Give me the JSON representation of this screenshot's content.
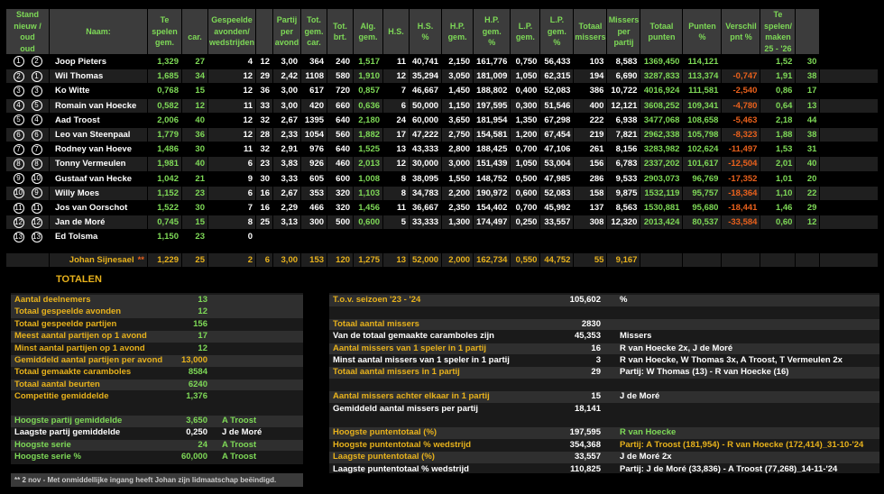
{
  "headers": [
    "Stand\nnieuw / oud\noud",
    "Naam:",
    "Te spelen\ngem.",
    "\ncar.",
    "Gespeelde\navonden/\nwedstrijden",
    "",
    "Partij\nper\navond",
    "Tot.\ngem.\ncar.",
    "Tot.\nbrt.",
    "Alg.\ngem.",
    "H.S.",
    "H.S.\n%",
    "H.P.\ngem.",
    "H.P.\ngem.\n%",
    "L.P.\ngem.",
    "L.P.\ngem.\n%",
    "Totaal\nmissers",
    "Missers\nper\npartij",
    "Totaal\npunten",
    "Punten\n%",
    "Verschil\npnt %",
    "Te spelen/\nmaken\n25 - '26",
    ""
  ],
  "players": [
    {
      "new": "1",
      "old": "2",
      "name": "Joop Pieters",
      "gem": "1,329",
      "car": "27",
      "avonden": "4",
      "partijen": "12",
      "per_avond": "3,00",
      "tot_car": "364",
      "brt": "240",
      "alg": "1,517",
      "alg_color": "g",
      "hs": "11",
      "hs_pct": "40,741",
      "hp": "2,150",
      "hp_pct": "161,776",
      "lp": "0,750",
      "lp_pct": "56,433",
      "missers": "103",
      "missers_pp": "8,583",
      "punten": "1369,450",
      "punten_pct": "114,121",
      "verschil": "",
      "ts_gem": "1,52",
      "ts_car": "30"
    },
    {
      "new": "2",
      "old": "1",
      "name": "Wil Thomas",
      "gem": "1,685",
      "car": "34",
      "avonden": "12",
      "partijen": "29",
      "per_avond": "2,42",
      "tot_car": "1108",
      "brt": "580",
      "alg": "1,910",
      "alg_color": "g",
      "hs": "12",
      "hs_pct": "35,294",
      "hp": "3,050",
      "hp_pct": "181,009",
      "lp": "1,050",
      "lp_pct": "62,315",
      "missers": "194",
      "missers_pp": "6,690",
      "punten": "3287,833",
      "punten_pct": "113,374",
      "verschil": "-0,747",
      "ts_gem": "1,91",
      "ts_car": "38"
    },
    {
      "new": "3",
      "old": "3",
      "name": "Ko Witte",
      "gem": "0,768",
      "car": "15",
      "avonden": "12",
      "partijen": "36",
      "per_avond": "3,00",
      "tot_car": "617",
      "brt": "720",
      "alg": "0,857",
      "alg_color": "g",
      "hs": "7",
      "hs_pct": "46,667",
      "hp": "1,450",
      "hp_pct": "188,802",
      "lp": "0,400",
      "lp_pct": "52,083",
      "missers": "386",
      "missers_pp": "10,722",
      "punten": "4016,924",
      "punten_pct": "111,581",
      "verschil": "-2,540",
      "ts_gem": "0,86",
      "ts_car": "17"
    },
    {
      "new": "4",
      "old": "5",
      "name": "Romain van Hoecke",
      "gem": "0,582",
      "car": "12",
      "avonden": "11",
      "partijen": "33",
      "per_avond": "3,00",
      "tot_car": "420",
      "brt": "660",
      "alg": "0,636",
      "alg_color": "g",
      "hs": "6",
      "hs_pct": "50,000",
      "hp": "1,150",
      "hp_pct": "197,595",
      "lp": "0,300",
      "lp_pct": "51,546",
      "missers": "400",
      "missers_pp": "12,121",
      "punten": "3608,252",
      "punten_pct": "109,341",
      "verschil": "-4,780",
      "ts_gem": "0,64",
      "ts_car": "13"
    },
    {
      "new": "5",
      "old": "4",
      "name": "Aad Troost",
      "gem": "2,006",
      "car": "40",
      "avonden": "12",
      "partijen": "32",
      "per_avond": "2,67",
      "tot_car": "1395",
      "brt": "640",
      "alg": "2,180",
      "alg_color": "g",
      "hs": "24",
      "hs_pct": "60,000",
      "hp": "3,650",
      "hp_pct": "181,954",
      "lp": "1,350",
      "lp_pct": "67,298",
      "missers": "222",
      "missers_pp": "6,938",
      "punten": "3477,068",
      "punten_pct": "108,658",
      "verschil": "-5,463",
      "ts_gem": "2,18",
      "ts_car": "44"
    },
    {
      "new": "6",
      "old": "6",
      "name": "Leo van Steenpaal",
      "gem": "1,779",
      "car": "36",
      "avonden": "12",
      "partijen": "28",
      "per_avond": "2,33",
      "tot_car": "1054",
      "brt": "560",
      "alg": "1,882",
      "alg_color": "g",
      "hs": "17",
      "hs_pct": "47,222",
      "hp": "2,750",
      "hp_pct": "154,581",
      "lp": "1,200",
      "lp_pct": "67,454",
      "missers": "219",
      "missers_pp": "7,821",
      "punten": "2962,338",
      "punten_pct": "105,798",
      "verschil": "-8,323",
      "ts_gem": "1,88",
      "ts_car": "38"
    },
    {
      "new": "7",
      "old": "7",
      "name": "Rodney van Hoeve",
      "gem": "1,486",
      "car": "30",
      "avonden": "11",
      "partijen": "32",
      "per_avond": "2,91",
      "tot_car": "976",
      "brt": "640",
      "alg": "1,525",
      "alg_color": "g",
      "hs": "13",
      "hs_pct": "43,333",
      "hp": "2,800",
      "hp_pct": "188,425",
      "lp": "0,700",
      "lp_pct": "47,106",
      "missers": "261",
      "missers_pp": "8,156",
      "punten": "3283,982",
      "punten_pct": "102,624",
      "verschil": "-11,497",
      "ts_gem": "1,53",
      "ts_car": "31"
    },
    {
      "new": "8",
      "old": "8",
      "name": "Tonny Vermeulen",
      "gem": "1,981",
      "car": "40",
      "avonden": "6",
      "partijen": "23",
      "per_avond": "3,83",
      "tot_car": "926",
      "brt": "460",
      "alg": "2,013",
      "alg_color": "g",
      "hs": "12",
      "hs_pct": "30,000",
      "hp": "3,000",
      "hp_pct": "151,439",
      "lp": "1,050",
      "lp_pct": "53,004",
      "missers": "156",
      "missers_pp": "6,783",
      "punten": "2337,202",
      "punten_pct": "101,617",
      "verschil": "-12,504",
      "ts_gem": "2,01",
      "ts_car": "40"
    },
    {
      "new": "9",
      "old": "10",
      "name": "Gustaaf van Hecke",
      "gem": "1,042",
      "car": "21",
      "avonden": "9",
      "partijen": "30",
      "per_avond": "3,33",
      "tot_car": "605",
      "brt": "600",
      "alg": "1,008",
      "alg_color": "g",
      "hs": "8",
      "hs_pct": "38,095",
      "hp": "1,550",
      "hp_pct": "148,752",
      "lp": "0,500",
      "lp_pct": "47,985",
      "missers": "286",
      "missers_pp": "9,533",
      "punten": "2903,073",
      "punten_pct": "96,769",
      "verschil": "-17,352",
      "ts_gem": "1,01",
      "ts_car": "20"
    },
    {
      "new": "10",
      "old": "9",
      "name": "Willy Moes",
      "gem": "1,152",
      "car": "23",
      "avonden": "6",
      "partijen": "16",
      "per_avond": "2,67",
      "tot_car": "353",
      "brt": "320",
      "alg": "1,103",
      "alg_color": "g",
      "hs": "8",
      "hs_pct": "34,783",
      "hp": "2,200",
      "hp_pct": "190,972",
      "lp": "0,600",
      "lp_pct": "52,083",
      "missers": "158",
      "missers_pp": "9,875",
      "punten": "1532,119",
      "punten_pct": "95,757",
      "verschil": "-18,364",
      "ts_gem": "1,10",
      "ts_car": "22"
    },
    {
      "new": "11",
      "old": "11",
      "name": "Jos van Oorschot",
      "gem": "1,522",
      "car": "30",
      "avonden": "7",
      "partijen": "16",
      "per_avond": "2,29",
      "tot_car": "466",
      "brt": "320",
      "alg": "1,456",
      "alg_color": "g",
      "hs": "11",
      "hs_pct": "36,667",
      "hp": "2,350",
      "hp_pct": "154,402",
      "lp": "0,700",
      "lp_pct": "45,992",
      "missers": "137",
      "missers_pp": "8,563",
      "punten": "1530,881",
      "punten_pct": "95,680",
      "verschil": "-18,441",
      "ts_gem": "1,46",
      "ts_car": "29"
    },
    {
      "new": "12",
      "old": "12",
      "name": "Jan de Moré",
      "gem": "0,745",
      "car": "15",
      "avonden": "8",
      "partijen": "25",
      "per_avond": "3,13",
      "tot_car": "300",
      "brt": "500",
      "alg": "0,600",
      "alg_color": "g",
      "hs": "5",
      "hs_pct": "33,333",
      "hp": "1,300",
      "hp_pct": "174,497",
      "lp": "0,250",
      "lp_pct": "33,557",
      "missers": "308",
      "missers_pp": "12,320",
      "punten": "2013,424",
      "punten_pct": "80,537",
      "verschil": "-33,584",
      "ts_gem": "0,60",
      "ts_car": "12"
    },
    {
      "new": "13",
      "old": "13",
      "name": "Ed Tolsma",
      "gem": "1,150",
      "car": "23",
      "avonden": "0",
      "partijen": "",
      "per_avond": "",
      "tot_car": "",
      "brt": "",
      "alg": "",
      "alg_color": "g",
      "hs": "",
      "hs_pct": "",
      "hp": "",
      "hp_pct": "",
      "lp": "",
      "lp_pct": "",
      "missers": "",
      "missers_pp": "",
      "punten": "",
      "punten_pct": "",
      "verschil": "",
      "ts_gem": "",
      "ts_car": ""
    }
  ],
  "johan": {
    "name": "Johan Sijnesael",
    "mark": "**",
    "gem": "1,229",
    "car": "25",
    "avonden": "2",
    "partijen": "6",
    "per_avond": "3,00",
    "tot_car": "153",
    "brt": "120",
    "alg": "1,275",
    "hs": "13",
    "hs_pct": "52,000",
    "hp": "2,000",
    "hp_pct": "162,734",
    "lp": "0,550",
    "lp_pct": "44,752",
    "missers": "55",
    "missers_pp": "9,167"
  },
  "totalen_title": "TOTALEN",
  "left_rows": [
    {
      "label": "Aantal deelnemers",
      "value": "13",
      "extra": "",
      "lc": "y",
      "vc": "g",
      "xc": "g",
      "hl": true
    },
    {
      "label": "Totaal gespeelde avonden",
      "value": "12",
      "extra": "",
      "lc": "y",
      "vc": "g",
      "xc": "g",
      "hl": true
    },
    {
      "label": "Totaal gespeelde partijen",
      "value": "156",
      "extra": "",
      "lc": "y",
      "vc": "g",
      "xc": "g",
      "hl": false
    },
    {
      "label": "Meest aantal partijen op 1 avond",
      "value": "17",
      "extra": "",
      "lc": "y",
      "vc": "g",
      "xc": "g",
      "hl": true
    },
    {
      "label": "Minst aantal partijen op 1 avond",
      "value": "12",
      "extra": "",
      "lc": "y",
      "vc": "g",
      "xc": "g",
      "hl": false
    },
    {
      "label": "Gemiddeld aantal partijen per avond",
      "value": "13,000",
      "extra": "",
      "lc": "y",
      "vc": "y",
      "xc": "g",
      "hl": true
    },
    {
      "label": "Totaal gemaakte caramboles",
      "value": "8584",
      "extra": "",
      "lc": "y",
      "vc": "g",
      "xc": "g",
      "hl": false
    },
    {
      "label": "Totaal aantal beurten",
      "value": "6240",
      "extra": "",
      "lc": "y",
      "vc": "g",
      "xc": "g",
      "hl": true
    },
    {
      "label": "Competitie gemiddelde",
      "value": "1,376",
      "extra": "",
      "lc": "y",
      "vc": "g",
      "xc": "g",
      "hl": false
    },
    {
      "label": "",
      "value": "",
      "extra": "",
      "lc": "y",
      "vc": "g",
      "xc": "g",
      "hl": false
    },
    {
      "label": "Hoogste partij gemiddelde",
      "value": "3,650",
      "extra": "A Troost",
      "lc": "g",
      "vc": "g",
      "xc": "g",
      "hl": true
    },
    {
      "label": "Laagste partij gemiddelde",
      "value": "0,250",
      "extra": "J de Moré",
      "lc": "w",
      "vc": "w",
      "xc": "w",
      "hl": false
    },
    {
      "label": "Hoogste serie",
      "value": "24",
      "extra": "A Troost",
      "lc": "g",
      "vc": "g",
      "xc": "g",
      "hl": true
    },
    {
      "label": "Hoogste serie %",
      "value": "60,000",
      "extra": "A Troost",
      "lc": "g",
      "vc": "g",
      "xc": "g",
      "hl": false
    }
  ],
  "footnote": "** 2 nov - Met onmiddellijke ingang heeft Johan zijn lidmaatschap beëindigd.",
  "right_rows": [
    {
      "label": "T.o.v. seizoen '23 - '24",
      "value": "105,602",
      "extra": "%",
      "lc": "y",
      "vc": "w",
      "xc": "w",
      "hl": true
    },
    {
      "label": "",
      "value": "",
      "extra": "",
      "lc": "w",
      "vc": "w",
      "xc": "w",
      "hl": false
    },
    {
      "label": "Totaal aantal missers",
      "value": "2830",
      "extra": "",
      "lc": "y",
      "vc": "w",
      "xc": "w",
      "hl": true
    },
    {
      "label": "Van de totaal gemaakte caramboles zijn",
      "value": "45,353",
      "extra": "Missers",
      "lc": "w",
      "vc": "w",
      "xc": "w",
      "hl": false
    },
    {
      "label": "Aantal missers van 1 speler in 1 partij",
      "value": "16",
      "extra": "R van Hoecke 2x, J de Moré",
      "lc": "y",
      "vc": "w",
      "xc": "w",
      "hl": true
    },
    {
      "label": "Minst aantal missers van 1 speler in 1 partij",
      "value": "3",
      "extra": "R van Hoecke, W Thomas 3x, A Troost, T Vermeulen 2x",
      "lc": "w",
      "vc": "w",
      "xc": "w",
      "hl": false
    },
    {
      "label": "Totaal aantal missers in 1 partij",
      "value": "29",
      "extra": "Partij: W Thomas (13) - R van Hoecke (16)",
      "lc": "y",
      "vc": "w",
      "xc": "w",
      "hl": true
    },
    {
      "label": "",
      "value": "",
      "extra": "",
      "lc": "w",
      "vc": "w",
      "xc": "w",
      "hl": false
    },
    {
      "label": "Aantal missers achter elkaar in 1 partij",
      "value": "15",
      "extra": "J de Moré",
      "lc": "y",
      "vc": "w",
      "xc": "w",
      "hl": true
    },
    {
      "label": "Gemiddeld aantal missers per partij",
      "value": "18,141",
      "extra": "",
      "lc": "w",
      "vc": "w",
      "xc": "w",
      "hl": false
    },
    {
      "label": "",
      "value": "",
      "extra": "",
      "lc": "w",
      "vc": "w",
      "xc": "w",
      "hl": false
    },
    {
      "label": "Hoogste puntentotaal (%)",
      "value": "197,595",
      "extra": "R van Hoecke",
      "lc": "y",
      "vc": "w",
      "xc": "g",
      "hl": true
    },
    {
      "label": "Hoogste puntentotaal % wedstrijd",
      "value": "354,368",
      "extra": "Partij: A Troost (181,954) - R van Hoecke (172,414)_31-10-'24",
      "lc": "y",
      "vc": "w",
      "xc": "y",
      "hl": false
    },
    {
      "label": "Laagste puntentotaal (%)",
      "value": "33,557",
      "extra": "J de Moré 2x",
      "lc": "y",
      "vc": "w",
      "xc": "w",
      "hl": true
    },
    {
      "label": "Laagste puntentotaal % wedstrijd",
      "value": "110,825",
      "extra": "Partij: J de Moré (33,836) - A Troost (77,268)_14-11-'24",
      "lc": "w",
      "vc": "w",
      "xc": "w",
      "hl": false
    }
  ]
}
